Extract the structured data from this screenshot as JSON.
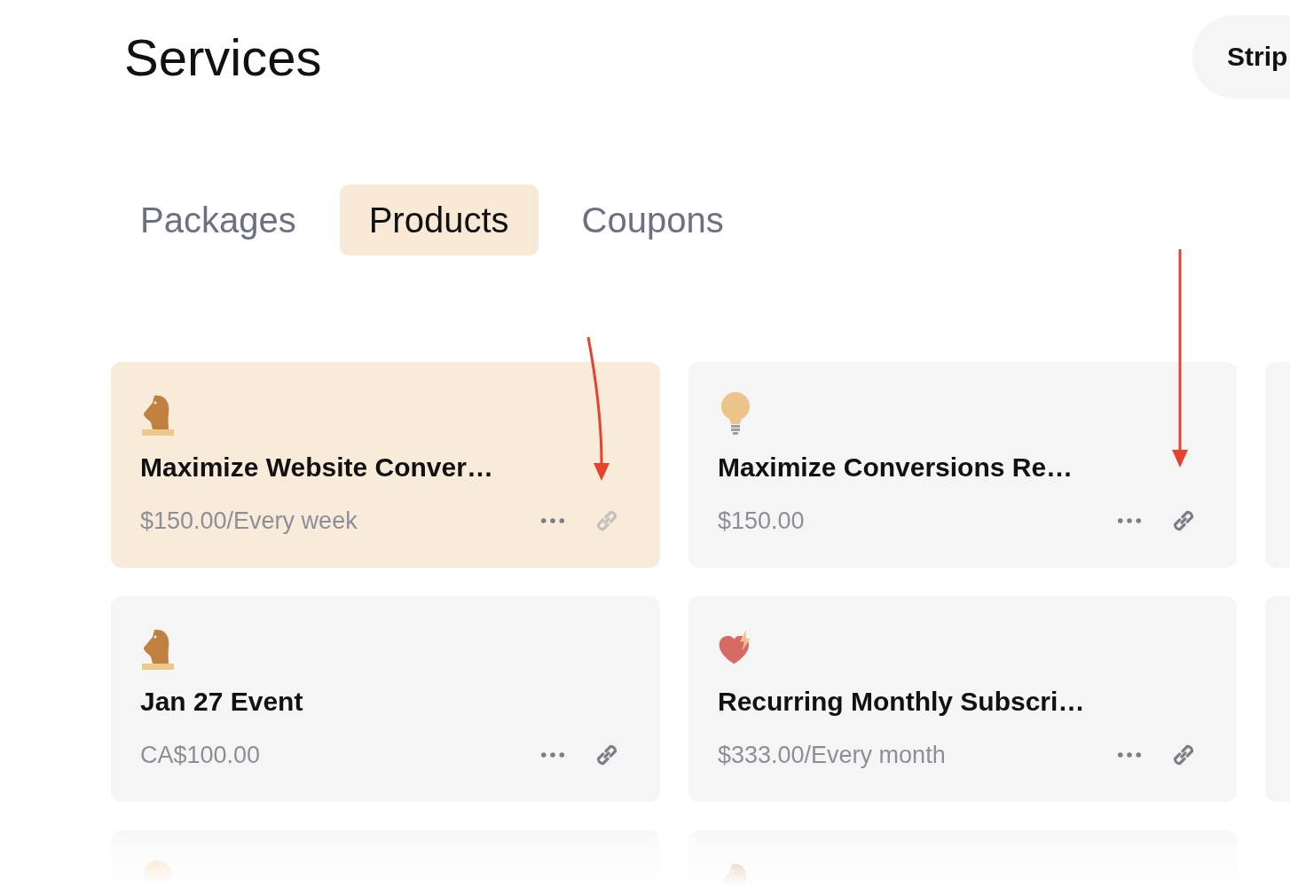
{
  "page": {
    "title": "Services"
  },
  "header_button": {
    "label": "Strip"
  },
  "tabs": [
    {
      "label": "Packages",
      "selected": false
    },
    {
      "label": "Products",
      "selected": true
    },
    {
      "label": "Coupons",
      "selected": false
    }
  ],
  "products": [
    {
      "kind": "knight",
      "title": "Maximize Website Conver…",
      "price": "$150.00/Every week",
      "selected": true
    },
    {
      "kind": "bulb",
      "title": "Maximize Conversions Re…",
      "price": "$150.00",
      "selected": false
    },
    {
      "kind": "blank",
      "selected": false
    },
    {
      "kind": "knight",
      "title": "Jan 27 Event",
      "price": "CA$100.00",
      "selected": false
    },
    {
      "kind": "heart",
      "title": "Recurring Monthly Subscri…",
      "price": "$333.00/Every month",
      "selected": false
    },
    {
      "kind": "blank",
      "selected": false
    },
    {
      "kind": "bulb",
      "selected": false
    },
    {
      "kind": "knight",
      "selected": false
    }
  ]
}
